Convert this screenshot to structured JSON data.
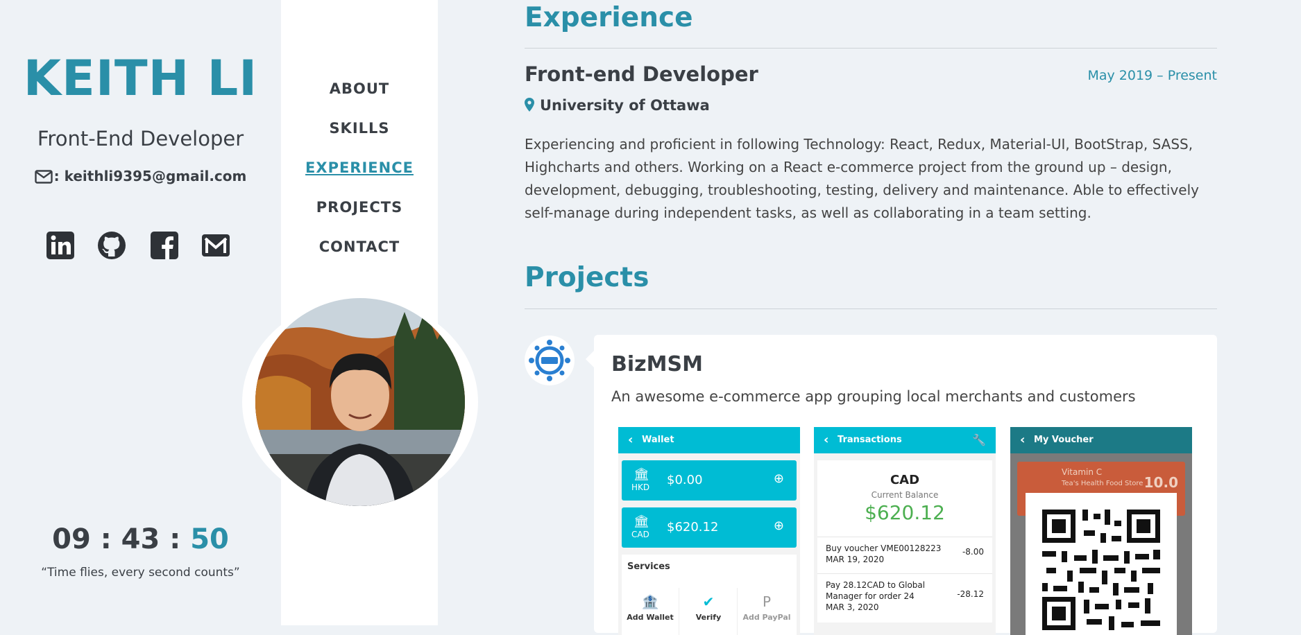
{
  "profile": {
    "name": "KEITH LI",
    "role": "Front-End Developer",
    "email_prefix": ":",
    "email": "keithli9395@gmail.com",
    "socials": [
      "linkedin-icon",
      "github-icon",
      "facebook-icon",
      "mail-icon"
    ]
  },
  "clock": {
    "hours": "09",
    "minutes": "43",
    "seconds": "50",
    "sep": ":",
    "quote": "“Time flies, every second counts”"
  },
  "nav": {
    "items": [
      {
        "label": "ABOUT"
      },
      {
        "label": "SKILLS"
      },
      {
        "label": "EXPERIENCE",
        "active": true
      },
      {
        "label": "PROJECTS"
      },
      {
        "label": "CONTACT"
      }
    ]
  },
  "experience": {
    "heading": "Experience",
    "title": "Front-end Developer",
    "date": "May 2019 – Present",
    "org": "University of Ottawa",
    "description": "Experiencing and proficient in following Technology: React, Redux, Material-UI, BootStrap, SASS, Highcharts and others. Working on a React e-commerce project from the ground up – design, development, debugging, troubleshooting, testing, delivery and maintenance. Able to effectively self-manage during independent tasks, as well as collaborating in a team setting."
  },
  "projects": {
    "heading": "Projects",
    "items": [
      {
        "title": "BizMSM",
        "description": "An awesome e-commerce app grouping local merchants and customers",
        "screens": {
          "wallet": {
            "title": "Wallet",
            "rows": [
              {
                "currency": "HKD",
                "amount": "$0.00"
              },
              {
                "currency": "CAD",
                "amount": "$620.12"
              }
            ],
            "services_label": "Services",
            "services": [
              "Add Wallet",
              "Verify",
              "Add PayPal"
            ]
          },
          "transactions": {
            "title": "Transactions",
            "currency": "CAD",
            "balance_label": "Current Balance",
            "balance": "$620.12",
            "rows": [
              {
                "text": "Buy voucher VME00128223",
                "date": "MAR 19, 2020",
                "amount": "-8.00"
              },
              {
                "text": "Pay 28.12CAD to Global Manager for order 24",
                "date": "MAR 3, 2020",
                "amount": "-28.12"
              }
            ]
          },
          "voucher": {
            "title": "My Voucher",
            "item": "Vitamin C",
            "item_sub": "Tea's Health Food Store",
            "item_value": "10.0"
          }
        }
      }
    ]
  },
  "colors": {
    "accent": "#2a8fa8",
    "app_teal": "#00bcd4",
    "text": "#3a3f45",
    "background": "#eef2f6"
  }
}
